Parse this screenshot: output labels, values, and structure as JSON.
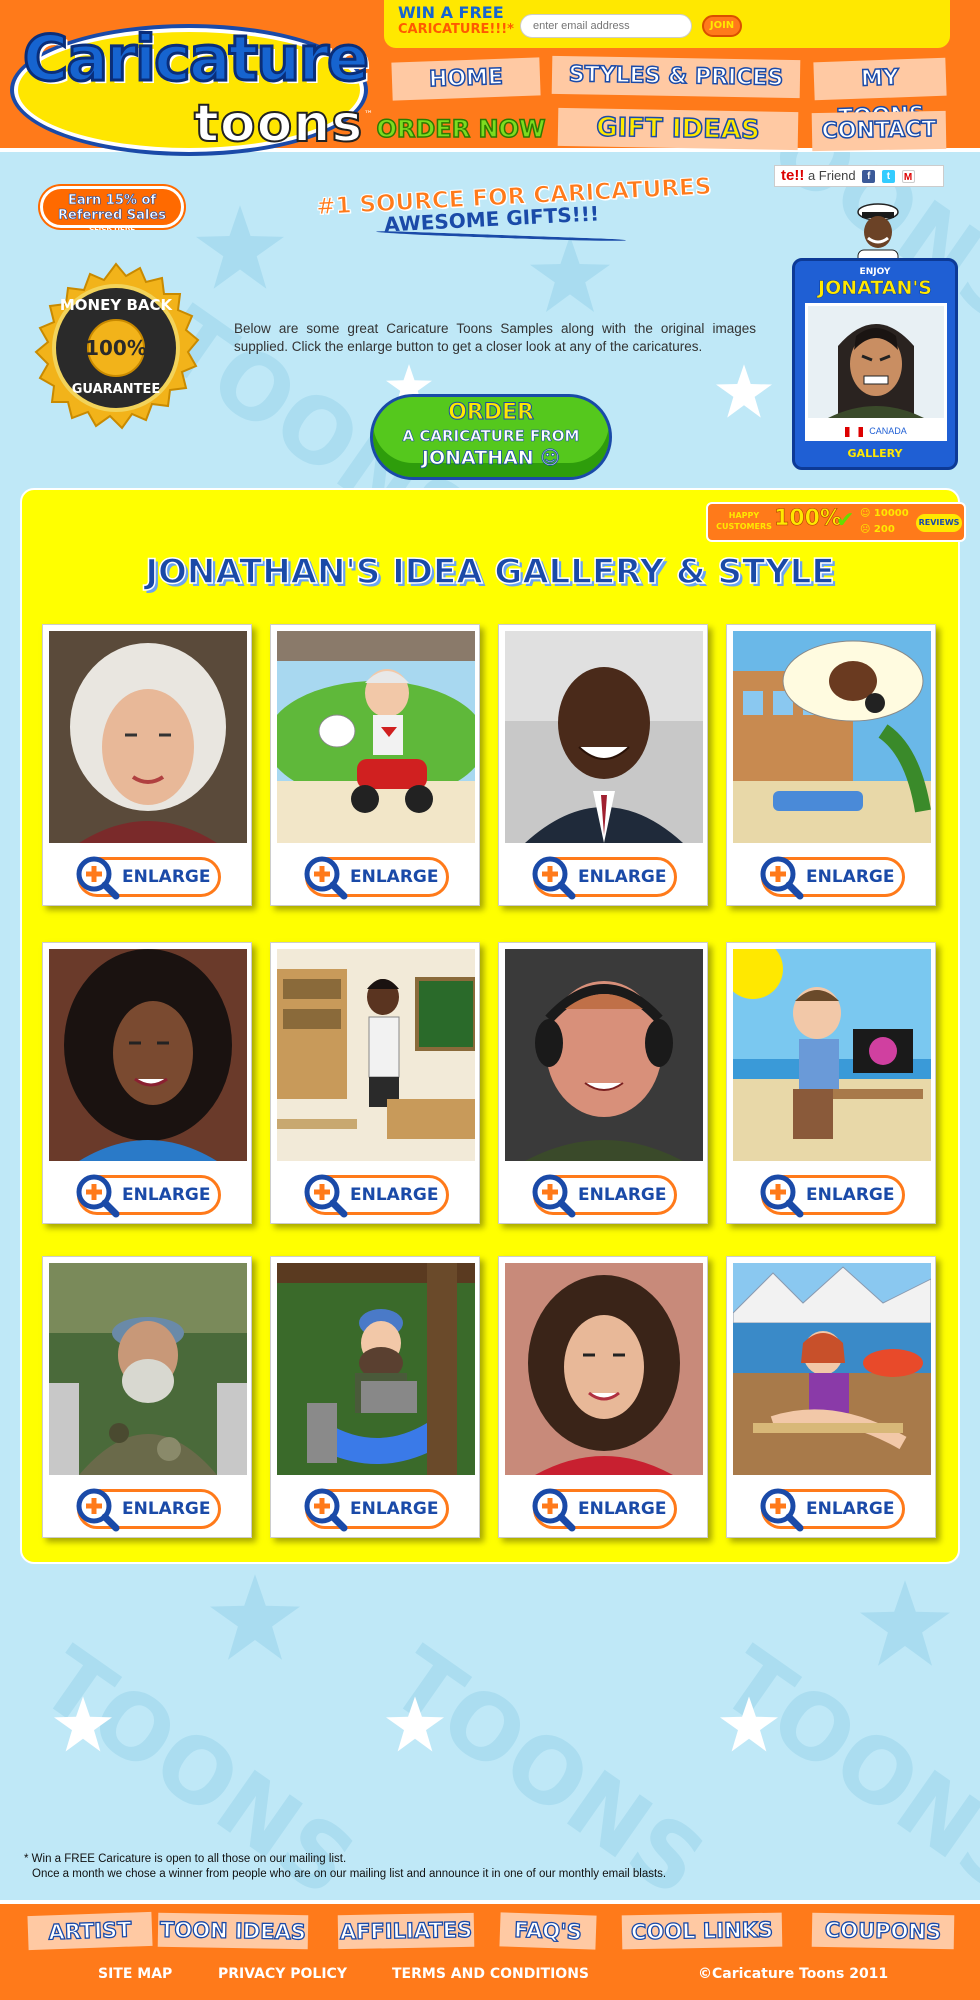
{
  "header": {
    "logo_main": "Caricature",
    "logo_sub": "toons",
    "logo_tm": "™",
    "win_title": "WIN A FREE",
    "win_subtitle": "CARICATURE!!!*",
    "email_placeholder": "enter email address",
    "join_label": "JOIN"
  },
  "nav": {
    "home": "HOME",
    "styles_prices": "STYLES & PRICES",
    "my_toons": "MY TOONS",
    "order_now": "ORDER NOW",
    "gift_ideas": "GIFT IDEAS",
    "contact": "CONTACT"
  },
  "promo": {
    "tell_prefix": "te!!",
    "tell_text": "a Friend",
    "earn_line1": "Earn 15% of",
    "earn_line2": "Referred Sales",
    "earn_line3": "CLICK HERE",
    "tagline1": "#1 SOURCE FOR CARICATURES",
    "tagline2": "AWESOME GIFTS!!!",
    "guarantee_top": "MONEY BACK",
    "guarantee_pct": "100%",
    "guarantee_bottom": "GUARANTEE",
    "intro": "Below are some great Caricature Toons Samples along with the original images supplied. Click the enlarge button to get a closer look at any of the caricatures.",
    "order_line1": "ORDER",
    "order_line2": "A CARICATURE FROM",
    "order_line3": "JONATHAN ☺"
  },
  "artist_card": {
    "enjoy": "ENJOY",
    "name": "JONATAN'S",
    "country": "CANADA",
    "gallery": "GALLERY"
  },
  "stats": {
    "label_line1": "HAPPY",
    "label_line2": "CUSTOMERS",
    "percent": "100%",
    "happy_count": "10000",
    "unhappy_count": "200",
    "reviews": "REVIEWS"
  },
  "gallery": {
    "title": "JONATHAN'S IDEA GALLERY & STYLE",
    "enlarge_label": "ENLARGE",
    "items": [
      {
        "kind": "photo",
        "subject": "older woman with white hair"
      },
      {
        "kind": "toon",
        "subject": "woman on red scooter with dog"
      },
      {
        "kind": "photo",
        "subject": "smiling man in suit"
      },
      {
        "kind": "toon",
        "subject": "beach hotel and motorcycle dream"
      },
      {
        "kind": "photo",
        "subject": "woman with dark curly hair"
      },
      {
        "kind": "toon",
        "subject": "teacher in classroom"
      },
      {
        "kind": "photo",
        "subject": "man with headphones"
      },
      {
        "kind": "toon",
        "subject": "man at desk by the sea"
      },
      {
        "kind": "photo",
        "subject": "bearded man in camouflage"
      },
      {
        "kind": "toon",
        "subject": "bearded man with laptop in forest"
      },
      {
        "kind": "photo",
        "subject": "woman with brown hair"
      },
      {
        "kind": "toon",
        "subject": "woman relaxing by mountain lake"
      }
    ]
  },
  "footnote": {
    "line1": "* Win a FREE Caricature is open to all those on our mailing list.",
    "line2": "Once a month we chose a winner from people who are on our mailing list and announce it in one of our monthly email blasts."
  },
  "footer": {
    "artist": "ARTIST",
    "toon_ideas": "TOON IDEAS",
    "affiliates": "AFFILIATES",
    "faqs": "FAQ'S",
    "cool_links": "COOL LINKS",
    "coupons": "COUPONS",
    "site_map": "SITE MAP",
    "privacy": "PRIVACY POLICY",
    "terms": "TERMS AND CONDITIONS",
    "copyright": "©Caricature Toons 2011"
  },
  "colors": {
    "orange": "#ff7a1a",
    "yellow": "#ffff00",
    "blue": "#1a4aa8",
    "sky": "#bfe8f7",
    "green": "#55c81d"
  }
}
